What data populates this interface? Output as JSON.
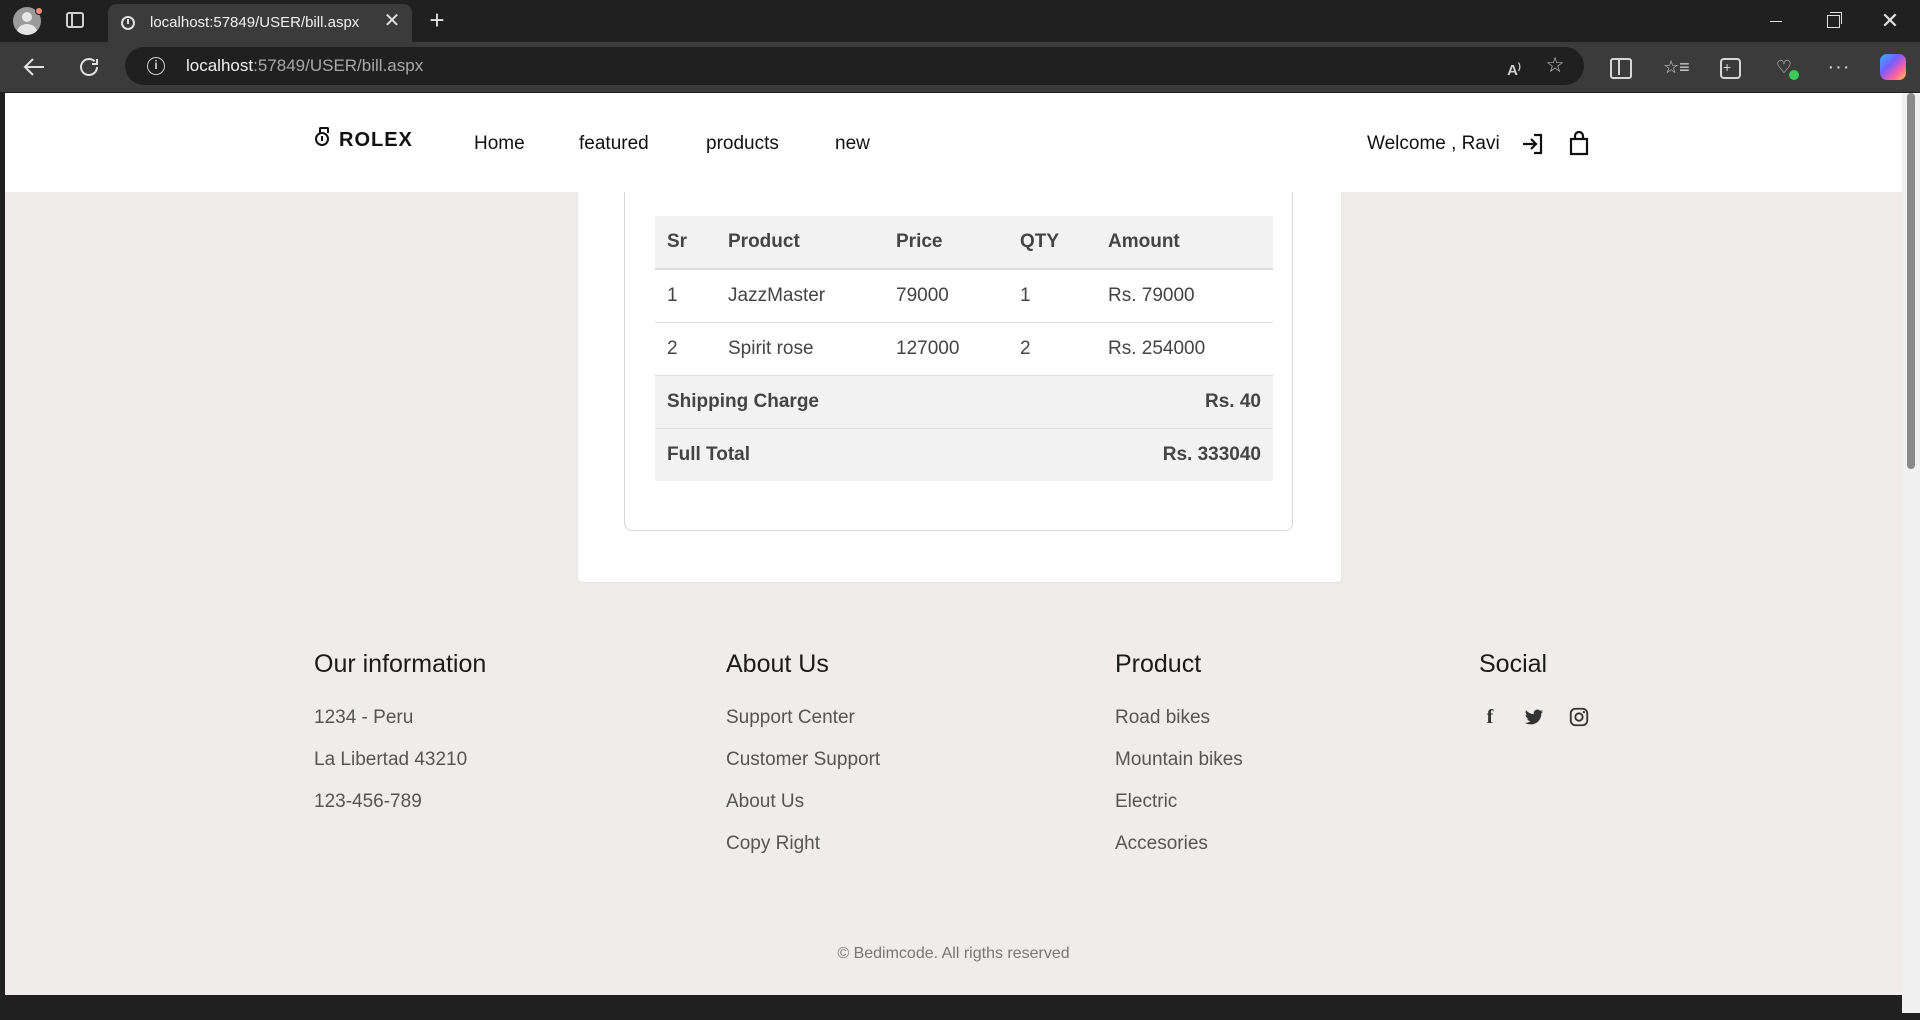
{
  "browser": {
    "tab_title": "localhost:57849/USER/bill.aspx",
    "url_host": "localhost",
    "url_rest": ":57849/USER/bill.aspx",
    "tab_close": "✕",
    "new_tab": "+",
    "win_close": "✕",
    "more": "···"
  },
  "header": {
    "logo": "ROLEX",
    "nav": [
      "Home",
      "featured",
      "products",
      "new"
    ],
    "welcome": "Welcome , Ravi"
  },
  "bill": {
    "columns": [
      "Sr",
      "Product",
      "Price",
      "QTY",
      "Amount"
    ],
    "rows": [
      {
        "sr": "1",
        "product": "JazzMaster",
        "price": "79000",
        "qty": "1",
        "amount": "Rs. 79000"
      },
      {
        "sr": "2",
        "product": "Spirit rose",
        "price": "127000",
        "qty": "2",
        "amount": "Rs. 254000"
      }
    ],
    "shipping_label": "Shipping Charge",
    "shipping_value": "Rs. 40",
    "total_label": "Full Total",
    "total_value": "Rs. 333040"
  },
  "footer": {
    "info": {
      "title": "Our information",
      "items": [
        "1234 - Peru",
        "La Libertad 43210",
        "123-456-789"
      ]
    },
    "about": {
      "title": "About Us",
      "items": [
        "Support Center",
        "Customer Support",
        "About Us",
        "Copy Right"
      ]
    },
    "product": {
      "title": "Product",
      "items": [
        "Road bikes",
        "Mountain bikes",
        "Electric",
        "Accesories"
      ]
    },
    "social": {
      "title": "Social",
      "icons": [
        "facebook-icon",
        "twitter-icon",
        "instagram-icon"
      ]
    },
    "copyright": "© Bedimcode. All rigths reserved"
  }
}
